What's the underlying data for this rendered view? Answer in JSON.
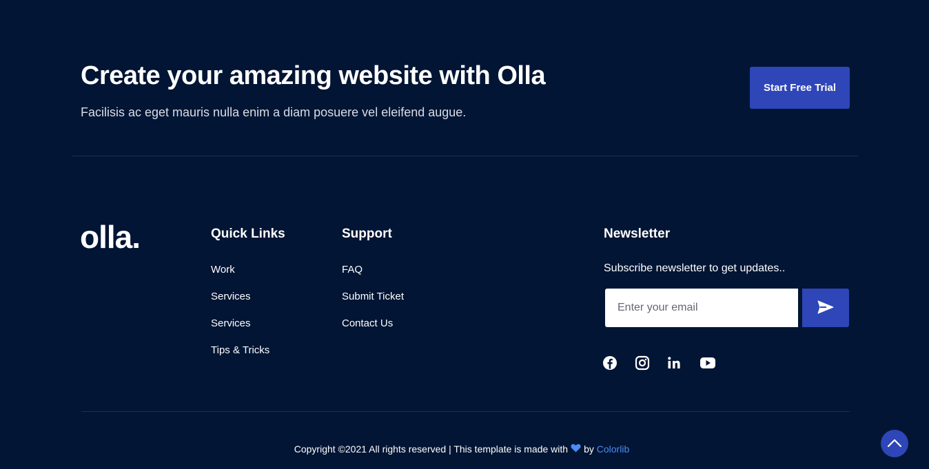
{
  "cta": {
    "title": "Create your amazing website with Olla",
    "subtitle": "Facilisis ac eget mauris nulla enim a diam posuere vel eleifend augue.",
    "button_label": "Start Free Trial"
  },
  "footer": {
    "logo_text": "olla.",
    "quick_links": {
      "title": "Quick Links",
      "items": [
        "Work",
        "Services",
        "Services",
        "Tips & Tricks"
      ]
    },
    "support": {
      "title": "Support",
      "items": [
        "FAQ",
        "Submit Ticket",
        "Contact Us"
      ]
    },
    "newsletter": {
      "title": "Newsletter",
      "text": "Subscribe newsletter to get updates..",
      "email_placeholder": "Enter your email"
    },
    "social_icons": [
      "facebook-icon",
      "instagram-icon",
      "linkedin-icon",
      "youtube-icon"
    ]
  },
  "copyright": {
    "prefix": "Copyright ©2021 All rights reserved | This template is made with",
    "by": "by",
    "link_text": "Colorlib"
  },
  "colors": {
    "background": "#021534",
    "accent": "#2e46b8",
    "link": "#4d8bf5"
  }
}
